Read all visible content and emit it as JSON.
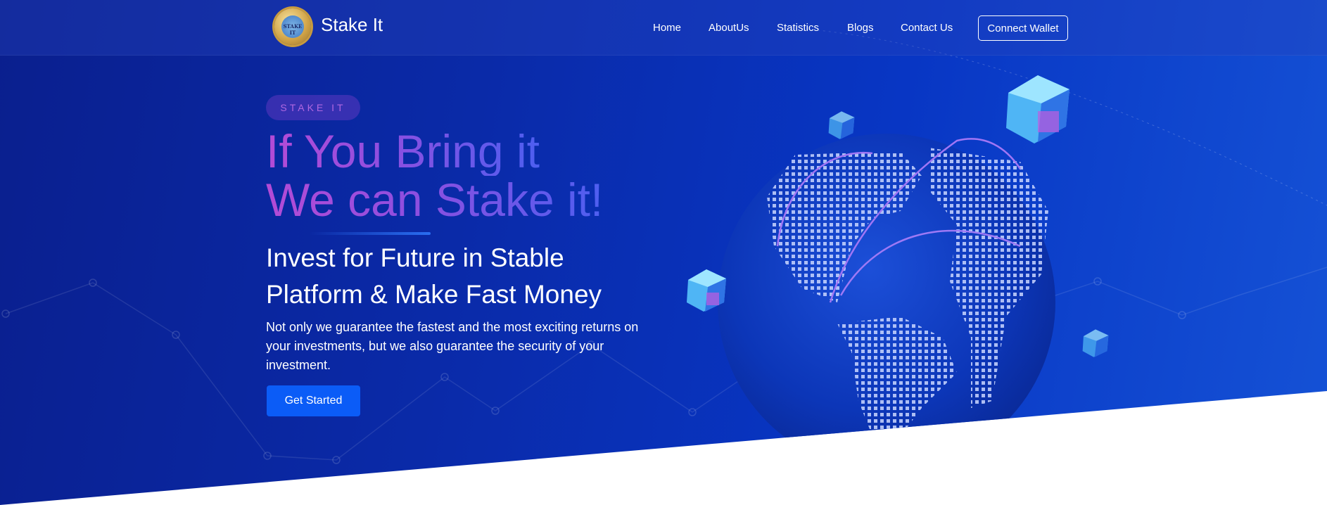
{
  "brand": {
    "name": "Stake It",
    "badge_text": "STAKE IT"
  },
  "nav": {
    "items": [
      "Home",
      "AboutUs",
      "Statistics",
      "Blogs",
      "Contact Us"
    ],
    "connect_label": "Connect Wallet"
  },
  "hero": {
    "pill": "STAKE IT",
    "headline_line1": "If You Bring it",
    "headline_line2": "We can Stake it!",
    "sub_line1": "Invest for Future in Stable",
    "sub_line2": "Platform & Make Fast Money",
    "description": "Not only we guarantee the fastest and the most exciting returns on your investments, but we also guarantee the security of your investment.",
    "cta_label": "Get Started"
  },
  "icons": [
    "logo-badge-icon",
    "globe-icon",
    "crypto-cube-icon"
  ],
  "colors": {
    "accent": "#0b5cf7",
    "headline_start": "#b44bd6",
    "headline_end": "#4d5ff0",
    "background": "#0a2aa8"
  }
}
